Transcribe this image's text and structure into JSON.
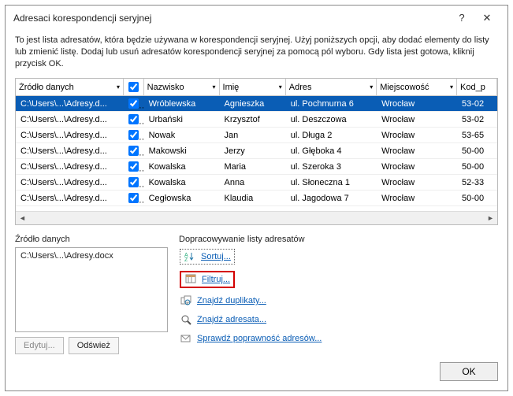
{
  "titlebar": {
    "title": "Adresaci korespondencji seryjnej",
    "help": "?",
    "close": "✕"
  },
  "description": "To jest lista adresatów, która będzie używana w korespondencji seryjnej. Użyj poniższych opcji, aby dodać elementy do listy lub zmienić listę. Dodaj lub usuń adresatów korespondencji seryjnej za pomocą pól wyboru. Gdy lista jest gotowa, kliknij przycisk OK.",
  "columns": {
    "c0": "Źródło danych",
    "c2": "Nazwisko",
    "c3": "Imię",
    "c4": "Adres",
    "c5": "Miejscowość",
    "c6": "Kod_p"
  },
  "rows": [
    {
      "src": "C:\\Users\\...\\Adresy.d...",
      "checked": true,
      "nazwisko": "Wróblewska",
      "imie": "Agnieszka",
      "adres": "ul. Pochmurna 6",
      "miasto": "Wrocław",
      "kod": "53-02",
      "sel": true
    },
    {
      "src": "C:\\Users\\...\\Adresy.d...",
      "checked": true,
      "nazwisko": "Urbański",
      "imie": "Krzysztof",
      "adres": "ul. Deszczowa",
      "miasto": "Wrocław",
      "kod": "53-02"
    },
    {
      "src": "C:\\Users\\...\\Adresy.d...",
      "checked": true,
      "nazwisko": "Nowak",
      "imie": "Jan",
      "adres": "ul. Długa 2",
      "miasto": "Wrocław",
      "kod": "53-65"
    },
    {
      "src": "C:\\Users\\...\\Adresy.d...",
      "checked": true,
      "nazwisko": "Makowski",
      "imie": "Jerzy",
      "adres": "ul. Głęboka 4",
      "miasto": "Wrocław",
      "kod": "50-00"
    },
    {
      "src": "C:\\Users\\...\\Adresy.d...",
      "checked": true,
      "nazwisko": "Kowalska",
      "imie": "Maria",
      "adres": "ul. Szeroka 3",
      "miasto": "Wrocław",
      "kod": "50-00"
    },
    {
      "src": "C:\\Users\\...\\Adresy.d...",
      "checked": true,
      "nazwisko": "Kowalska",
      "imie": "Anna",
      "adres": "ul. Słoneczna 1",
      "miasto": "Wrocław",
      "kod": "52-33"
    },
    {
      "src": "C:\\Users\\...\\Adresy.d...",
      "checked": true,
      "nazwisko": "Cegłowska",
      "imie": "Klaudia",
      "adres": "ul. Jagodowa 7",
      "miasto": "Wrocław",
      "kod": "50-00"
    }
  ],
  "source": {
    "label": "Źródło danych",
    "path": "C:\\Users\\...\\Adresy.docx",
    "edit": "Edytuj...",
    "refresh": "Odśwież"
  },
  "refine": {
    "label": "Dopracowywanie listy adresatów",
    "sort": "Sortuj...",
    "filter": "Filtruj...",
    "dupes": "Znajdź duplikaty...",
    "find": "Znajdź adresata...",
    "validate": "Sprawdź poprawność adresów..."
  },
  "footer": {
    "ok": "OK"
  },
  "glyphs": {
    "dropdown": "▾",
    "larrow": "◄",
    "rarrow": "►"
  }
}
